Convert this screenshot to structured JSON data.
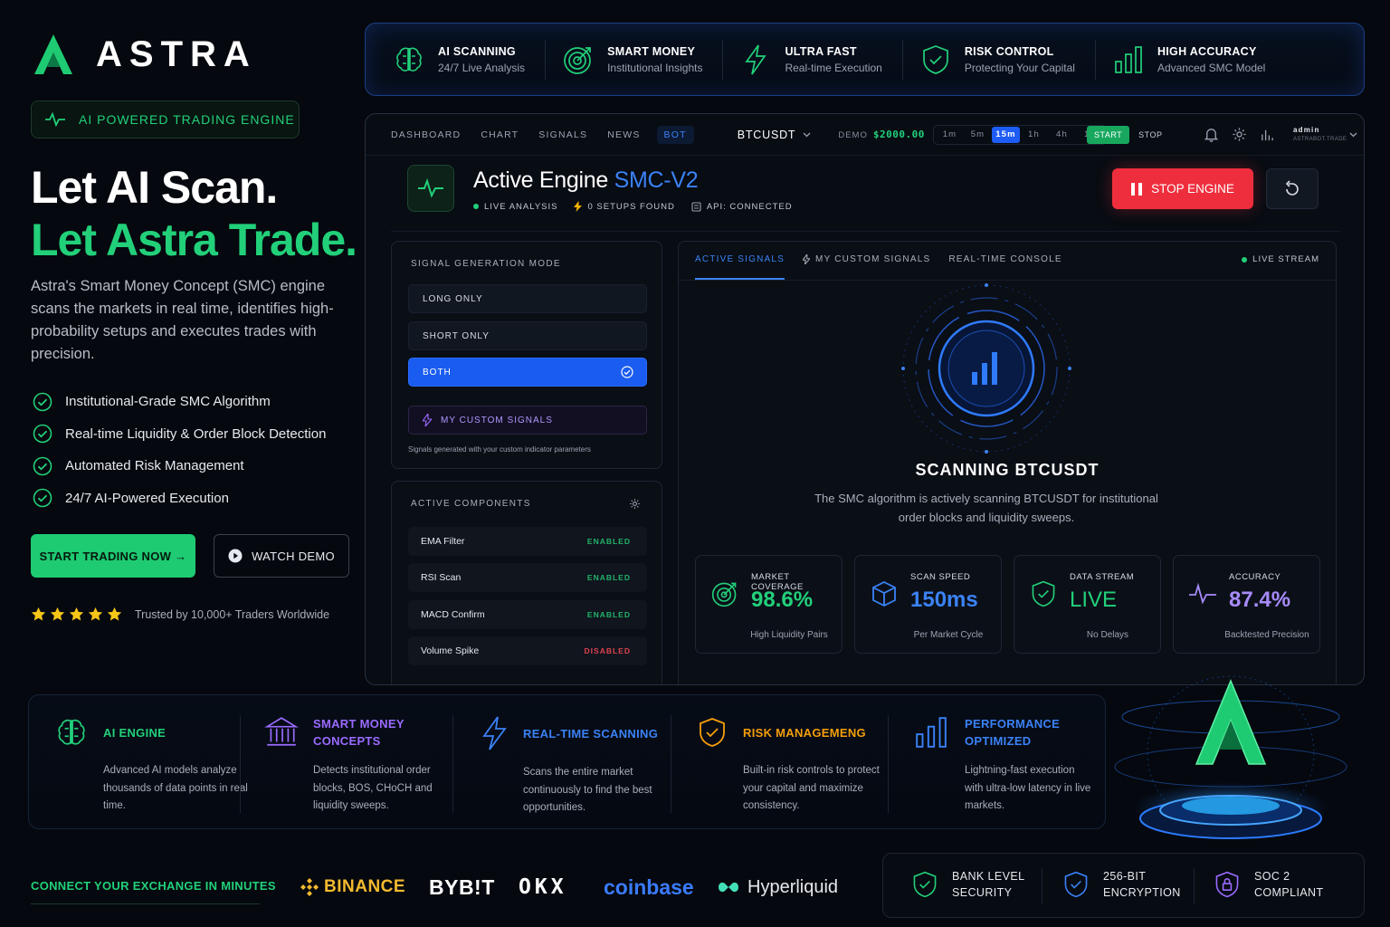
{
  "brand": {
    "name": "ASTRA",
    "badge": "AI POWERED TRADING ENGINE"
  },
  "hero": {
    "headline_1": "Let AI Scan.",
    "headline_2": "Let Astra Trade.",
    "lead": "Astra's Smart Money Concept (SMC) engine scans the markets in real time, identifies high-probability setups and executes trades with precision.",
    "checks": [
      "Institutional-Grade SMC Algorithm",
      "Real-time Liquidity & Order Block Detection",
      "Automated Risk Management",
      "24/7 AI-Powered Execution"
    ],
    "cta_primary": "START TRADING NOW →",
    "cta_secondary": "WATCH DEMO",
    "rating": 5,
    "trust": "Trusted by 10,000+ Traders Worldwide"
  },
  "features_strip": [
    {
      "icon": "brain-icon",
      "title": "AI SCANNING",
      "sub": "24/7 Live Analysis"
    },
    {
      "icon": "target-icon",
      "title": "SMART MONEY",
      "sub": "Institutional Insights"
    },
    {
      "icon": "lightning-icon",
      "title": "ULTRA FAST",
      "sub": "Real-time Execution"
    },
    {
      "icon": "shield-check-icon",
      "title": "RISK CONTROL",
      "sub": "Protecting Your Capital"
    },
    {
      "icon": "bar-chart-icon",
      "title": "HIGH ACCURACY",
      "sub": "Advanced SMC Model"
    }
  ],
  "app": {
    "nav": [
      "DASHBOARD",
      "CHART",
      "SIGNALS",
      "NEWS",
      "BOT"
    ],
    "nav_active": "BOT",
    "pair": "BTCUSDT",
    "demo_label": "DEMO",
    "demo_balance": "$2000.00",
    "timeframes": [
      "1m",
      "5m",
      "15m",
      "1h",
      "4h",
      "1d"
    ],
    "timeframe_active": "15m",
    "start": "START",
    "stop": "STOP",
    "user": "admin",
    "user_sub": "ASTRABOT.TRADE",
    "engine": {
      "title": "Active Engine",
      "version": "SMC-V2",
      "meta": [
        "LIVE ANALYSIS",
        "0 SETUPS FOUND",
        "API: CONNECTED"
      ],
      "stop_btn": "STOP ENGINE"
    },
    "signal_mode": {
      "title": "SIGNAL GENERATION MODE",
      "options": [
        "LONG ONLY",
        "SHORT ONLY",
        "BOTH"
      ],
      "selected": "BOTH",
      "custom": "MY CUSTOM SIGNALS",
      "note": "Signals generated with your custom indicator parameters"
    },
    "components": {
      "title": "ACTIVE COMPONENTS",
      "items": [
        {
          "name": "EMA Filter",
          "status": "ENABLED"
        },
        {
          "name": "RSI Scan",
          "status": "ENABLED"
        },
        {
          "name": "MACD Confirm",
          "status": "ENABLED"
        },
        {
          "name": "Volume Spike",
          "status": "DISABLED"
        }
      ]
    },
    "tabs": [
      "ACTIVE SIGNALS",
      "MY CUSTOM SIGNALS",
      "REAL-TIME CONSOLE"
    ],
    "live_stream": "LIVE STREAM",
    "scan": {
      "title": "SCANNING BTCUSDT",
      "desc": "The SMC algorithm is actively scanning BTCUSDT for institutional order blocks and liquidity sweeps."
    },
    "stats": [
      {
        "label": "MARKET COVERAGE",
        "value": "98.6%",
        "sub": "High Liquidity Pairs",
        "color": "#22d07a",
        "icon": "target-icon"
      },
      {
        "label": "SCAN SPEED",
        "value": "150ms",
        "sub": "Per Market Cycle",
        "color": "#3b82f6",
        "icon": "cube-icon"
      },
      {
        "label": "DATA STREAM",
        "value": "LIVE",
        "sub": "No Delays",
        "color": "#22d07a",
        "icon": "shield-check-icon"
      },
      {
        "label": "ACCURACY",
        "value": "87.4%",
        "sub": "Backtested Precision",
        "color": "#a78bfa",
        "icon": "pulse-icon"
      }
    ]
  },
  "bottom_features": [
    {
      "title": "AI ENGINE",
      "desc": "Advanced AI models analyze thousands of data points in real time.",
      "color": "#22d07a"
    },
    {
      "title": "SMART MONEY CONCEPTS",
      "desc": "Detects institutional order blocks, BOS, CHoCH and liquidity sweeps.",
      "color": "#9b6bff"
    },
    {
      "title": "REAL-TIME SCANNING",
      "desc": "Scans the entire market continuously to find the best opportunities.",
      "color": "#3b82f6"
    },
    {
      "title": "RISK MANAGEMENG",
      "desc": "Built-in risk controls to protect your capital and maximize consistency.",
      "color": "#f59e0b"
    },
    {
      "title": "PERFORMANCE OPTIMIZED",
      "desc": "Lightning-fast execution with ultra-low latency in live markets.",
      "color": "#3b82f6"
    }
  ],
  "exchanges": {
    "label": "CONNECT YOUR EXCHANGE IN MINUTES",
    "list": [
      "BINANCE",
      "BYB!T",
      "OKX",
      "coinbase",
      "Hyperliquid"
    ]
  },
  "security": [
    {
      "title": "BANK LEVEL SECURITY",
      "line1": "BANK LEVEL",
      "line2": "SECURITY",
      "color": "#22d07a"
    },
    {
      "title": "256-BIT ENCRYPTION",
      "line1": "256-BIT",
      "line2": "ENCRYPTION",
      "color": "#3b82f6"
    },
    {
      "title": "SOC 2 COMPLIANT",
      "line1": "SOC 2",
      "line2": "COMPLIANT",
      "color": "#9b6bff"
    }
  ]
}
